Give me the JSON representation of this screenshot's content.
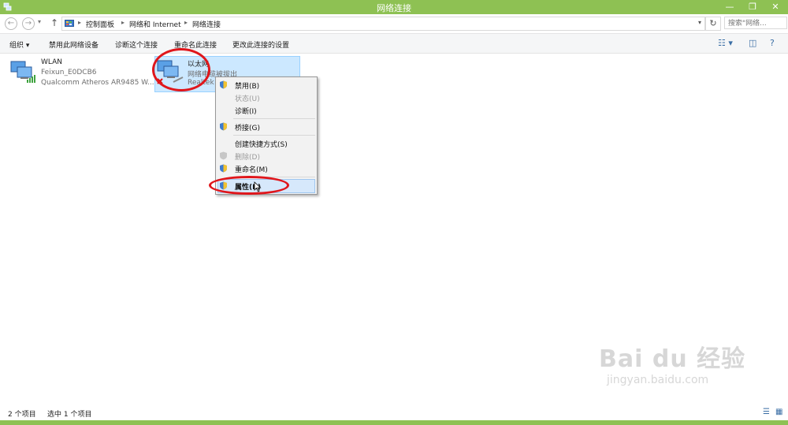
{
  "window": {
    "title": "网络连接",
    "min": "—",
    "max": "❐",
    "close": "✕"
  },
  "address": {
    "breadcrumbs": [
      "控制面板",
      "网络和 Internet",
      "网络连接"
    ],
    "refresh": "↻",
    "search_placeholder": "搜索\"网络..."
  },
  "toolbar": {
    "organize": "组织 ▾",
    "disable": "禁用此网络设备",
    "diagnose": "诊断这个连接",
    "rename": "重命名此连接",
    "change_settings": "更改此连接的设置"
  },
  "connections": [
    {
      "name": "WLAN",
      "line2": "Feixun_E0DCB6",
      "line3": "Qualcomm Atheros AR9485 W..."
    },
    {
      "name": "以太网",
      "line2": "网络电缆被拔出",
      "line3": "Realtek"
    }
  ],
  "context_menu": {
    "items": [
      {
        "label": "禁用(B)",
        "disabled": false,
        "shield": true
      },
      {
        "label": "状态(U)",
        "disabled": true,
        "shield": false
      },
      {
        "label": "诊断(I)",
        "disabled": false,
        "shield": false
      },
      {
        "label": "桥接(G)",
        "disabled": false,
        "shield": true
      },
      {
        "label": "创建快捷方式(S)",
        "disabled": false,
        "shield": false
      },
      {
        "label": "删除(D)",
        "disabled": true,
        "shield": true
      },
      {
        "label": "重命名(M)",
        "disabled": false,
        "shield": true
      },
      {
        "label": "属性(R)",
        "disabled": false,
        "shield": true
      }
    ]
  },
  "status": {
    "count": "2 个项目",
    "selected": "选中 1 个项目"
  },
  "watermark": {
    "brand": "Bai du 经验",
    "url": "jingyan.baidu.com"
  },
  "colors": {
    "accent": "#8ec153",
    "highlight": "#cce8ff",
    "annotation": "#e0161b"
  }
}
